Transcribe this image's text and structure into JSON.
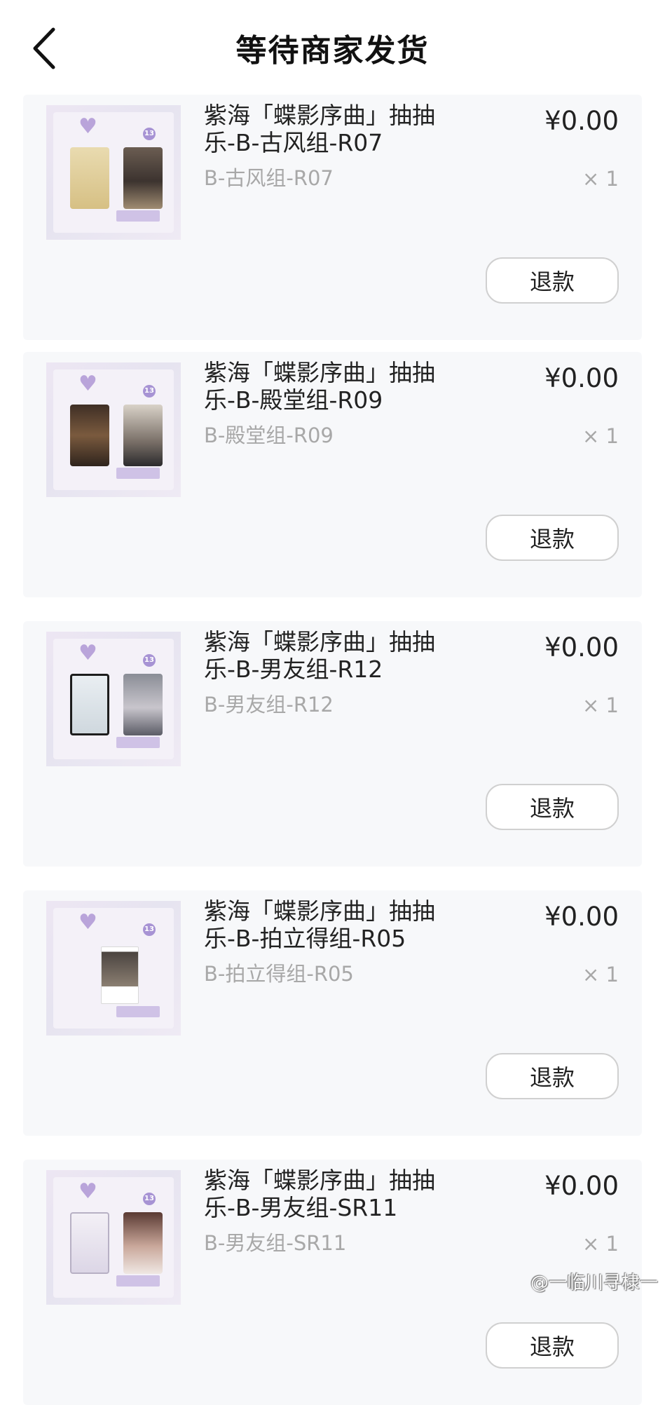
{
  "header": {
    "title": "等待商家发货"
  },
  "orders": [
    {
      "title": "紫海「蝶影序曲」抽抽乐-B-古风组-R07",
      "variant": "B-古风组-R07",
      "price": "¥0.00",
      "quantity": "× 1",
      "refund_label": "退款"
    },
    {
      "title": "紫海「蝶影序曲」抽抽乐-B-殿堂组-R09",
      "variant": "B-殿堂组-R09",
      "price": "¥0.00",
      "quantity": "× 1",
      "refund_label": "退款"
    },
    {
      "title": "紫海「蝶影序曲」抽抽乐-B-男友组-R12",
      "variant": "B-男友组-R12",
      "price": "¥0.00",
      "quantity": "× 1",
      "refund_label": "退款"
    },
    {
      "title": "紫海「蝶影序曲」抽抽乐-B-拍立得组-R05",
      "variant": "B-拍立得组-R05",
      "price": "¥0.00",
      "quantity": "× 1",
      "refund_label": "退款"
    },
    {
      "title": "紫海「蝶影序曲」抽抽乐-B-男友组-SR11",
      "variant": "B-男友组-SR11",
      "price": "¥0.00",
      "quantity": "× 1",
      "refund_label": "退款"
    }
  ],
  "watermark": "@一临川寻棣一"
}
